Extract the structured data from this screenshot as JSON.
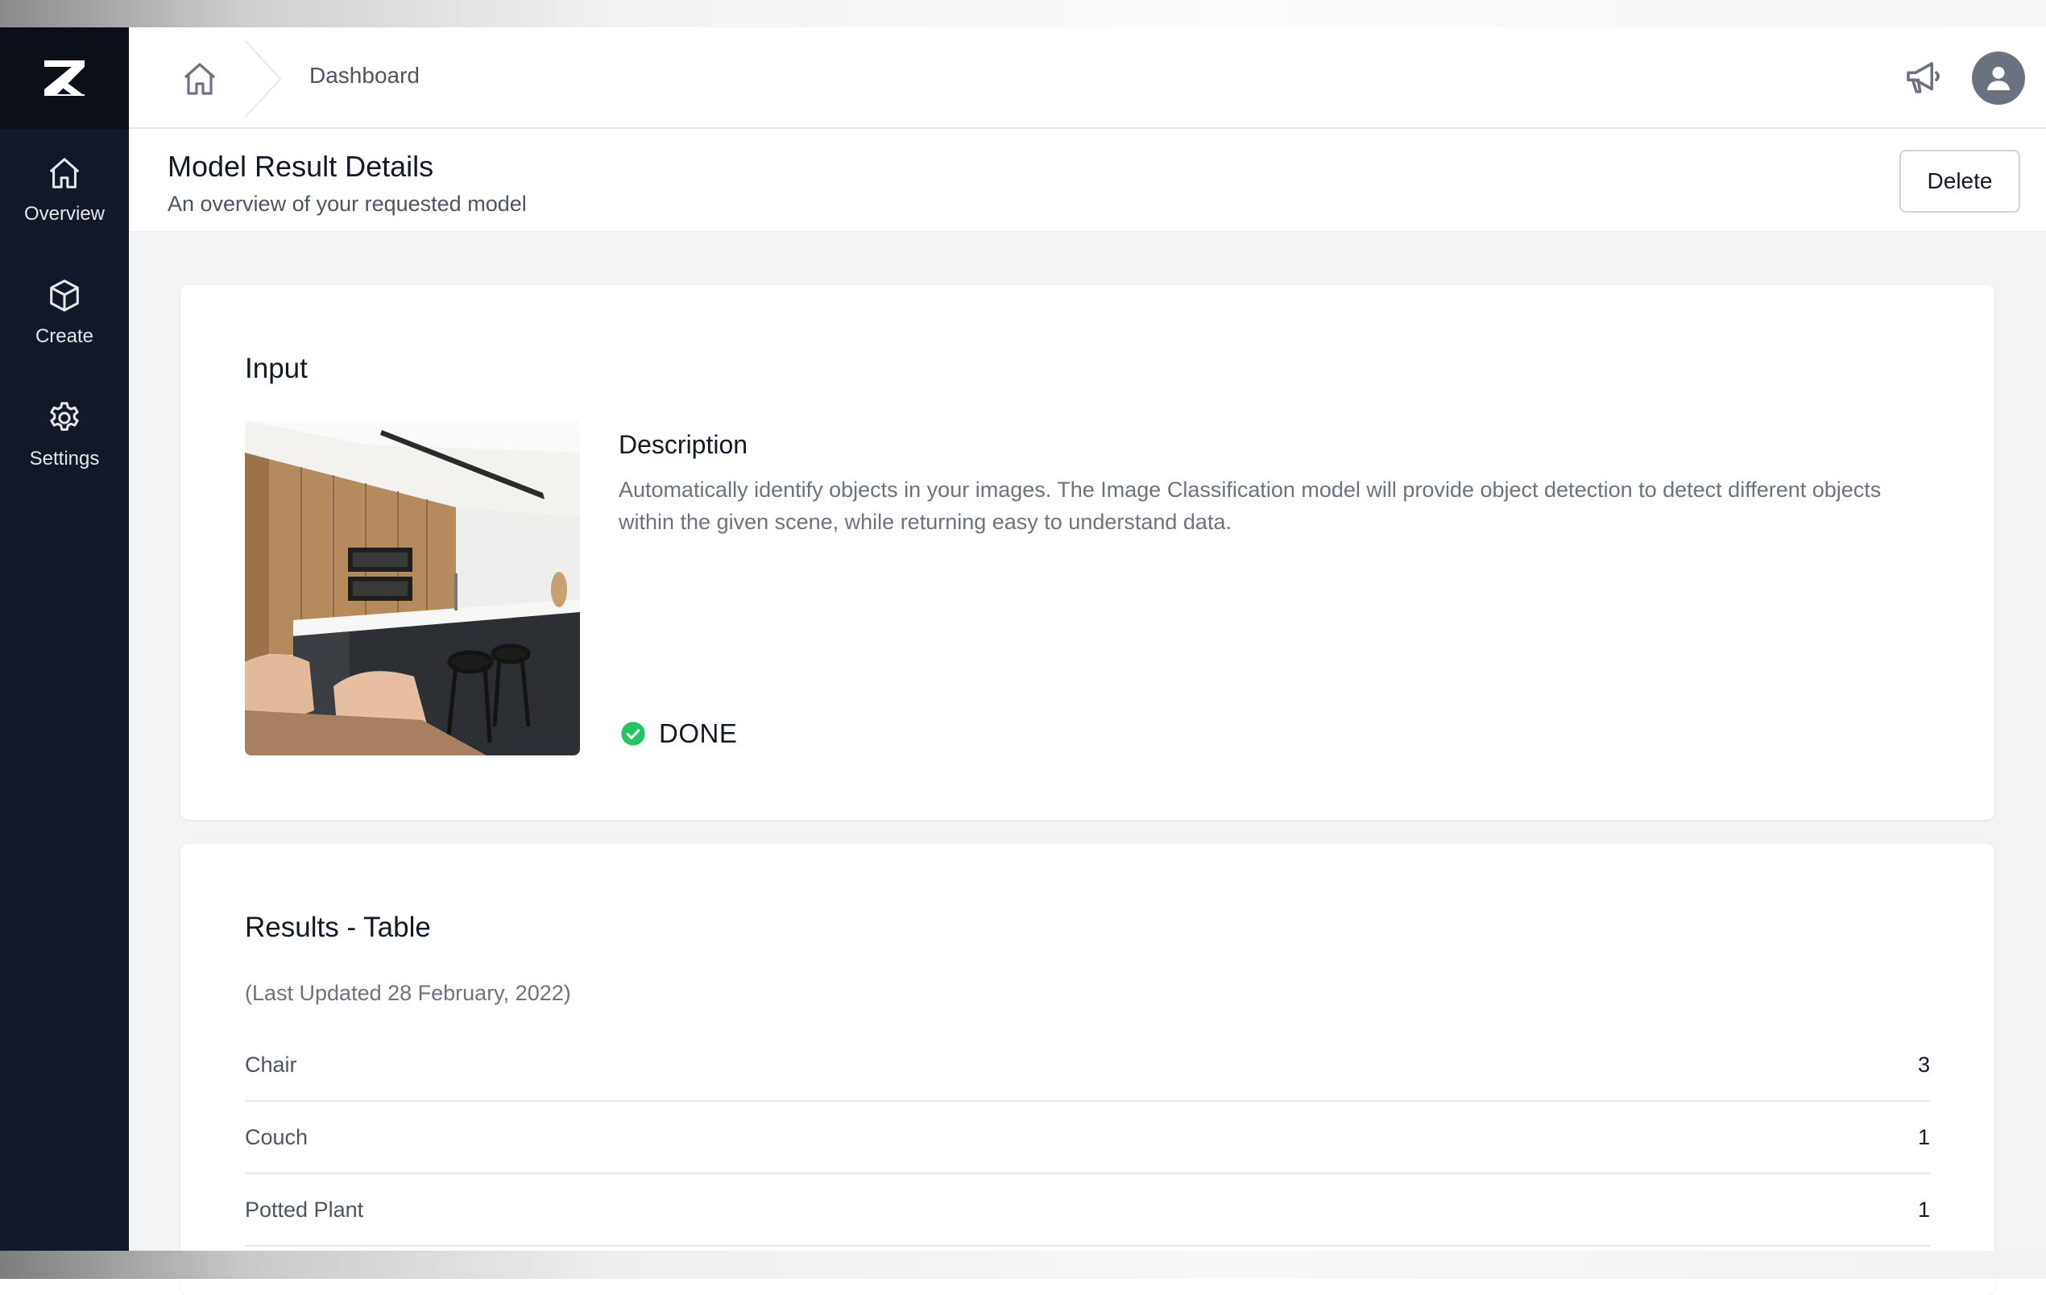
{
  "sidebar": {
    "items": [
      {
        "label": "Overview",
        "icon": "home-icon"
      },
      {
        "label": "Create",
        "icon": "cube-icon"
      },
      {
        "label": "Settings",
        "icon": "gear-icon"
      }
    ]
  },
  "header": {
    "breadcrumb": "Dashboard"
  },
  "page": {
    "title": "Model Result Details",
    "subtitle": "An overview of your requested model",
    "delete_label": "Delete"
  },
  "input_card": {
    "heading": "Input",
    "description_title": "Description",
    "description": "Automatically identify objects in your images. The Image Classification model will provide object detection to detect different objects within the given scene, while returning easy to understand data.",
    "status": "DONE",
    "status_color": "#22c55e"
  },
  "results_card": {
    "heading": "Results - Table",
    "last_updated": "(Last Updated 28 February, 2022)",
    "rows": [
      {
        "label": "Chair",
        "value": "3"
      },
      {
        "label": "Couch",
        "value": "1"
      },
      {
        "label": "Potted Plant",
        "value": "1"
      }
    ]
  },
  "colors": {
    "sidebar_bg": "#111827",
    "page_bg": "#f3f4f6",
    "success": "#22c55e"
  }
}
